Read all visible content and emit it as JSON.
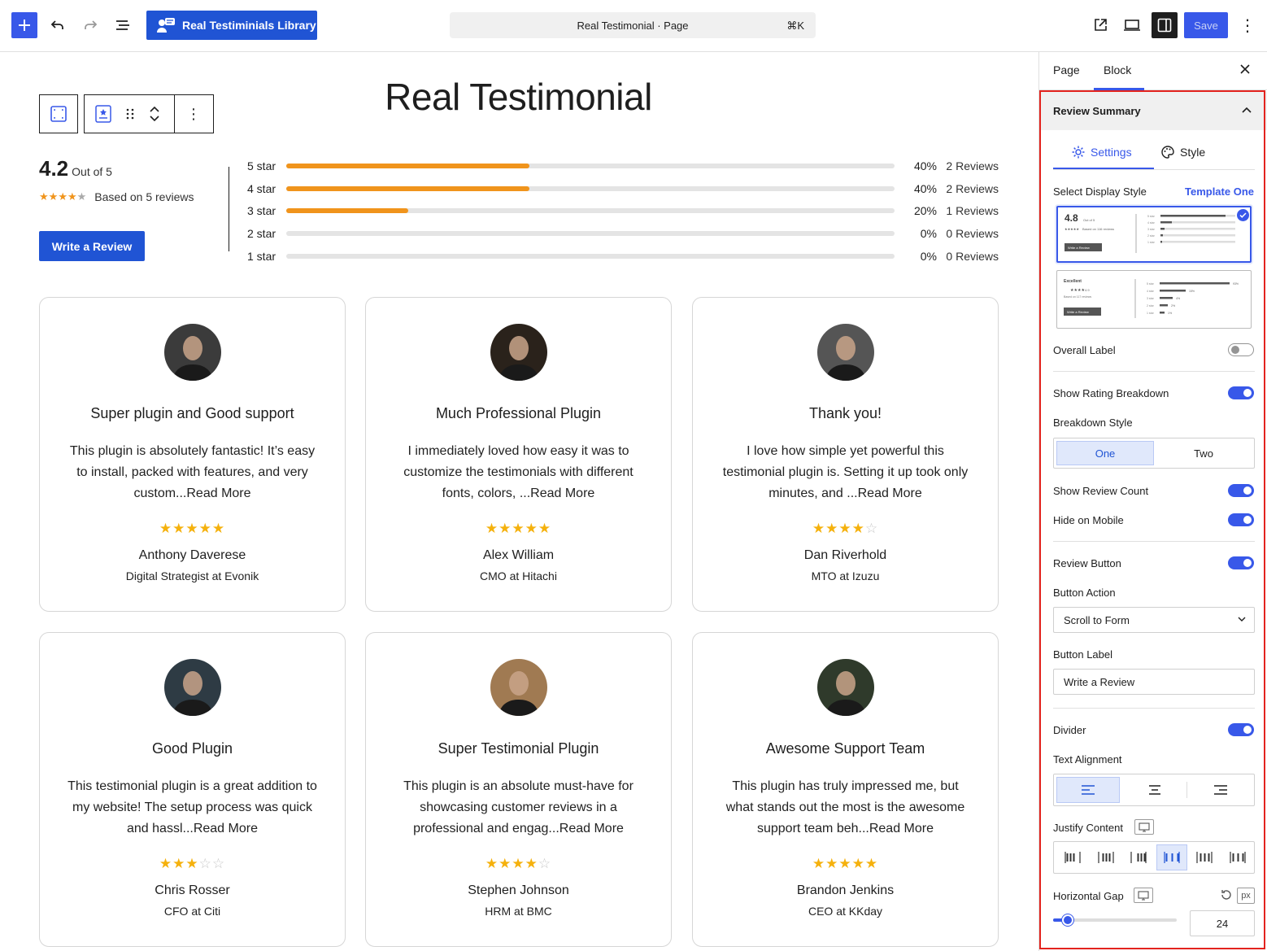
{
  "topbar": {
    "library_label": "Real Testiminials Library",
    "doc_title": "Real Testimonial · Page",
    "shortcut": "⌘K",
    "save_label": "Save"
  },
  "page": {
    "heading": "Real Testimonial"
  },
  "summary": {
    "average": "4.2",
    "out_of": "Out of 5",
    "based_on": "Based on 5 reviews",
    "average_stars": 4,
    "write_button": "Write a Review",
    "breakdown": [
      {
        "label": "5 star",
        "percent_text": "40%",
        "percent": 40,
        "count": "2 Reviews"
      },
      {
        "label": "4 star",
        "percent_text": "40%",
        "percent": 40,
        "count": "2 Reviews"
      },
      {
        "label": "3 star",
        "percent_text": "20%",
        "percent": 20,
        "count": "1 Reviews"
      },
      {
        "label": "2 star",
        "percent_text": "0%",
        "percent": 0,
        "count": "0 Reviews"
      },
      {
        "label": "1 star",
        "percent_text": "0%",
        "percent": 0,
        "count": "0 Reviews"
      }
    ]
  },
  "testimonials": [
    {
      "title": "Super plugin and Good support",
      "body": "This plugin is absolutely fantastic! It’s easy to install, packed with features, and very custom...Read More",
      "rating": 5,
      "name": "Anthony Daverese",
      "role": "Digital Strategist at Evonik",
      "avatar_color": "#3b3b3b"
    },
    {
      "title": "Much Professional Plugin",
      "body": "I immediately loved how easy it was to customize the testimonials with different fonts, colors, ...Read More",
      "rating": 5,
      "name": "Alex William",
      "role": "CMO at Hitachi",
      "avatar_color": "#2a221b"
    },
    {
      "title": "Thank you!",
      "body": "I love how simple yet powerful this testimonial plugin is. Setting it up took only minutes, and ...Read More",
      "rating": 4,
      "name": "Dan Riverhold",
      "role": "MTO at Izuzu",
      "avatar_color": "#555555"
    },
    {
      "title": "Good Plugin",
      "body": "This testimonial plugin is a great addition to my website! The setup process was quick and hassl...Read More",
      "rating": 3,
      "name": "Chris Rosser",
      "role": "CFO at Citi",
      "avatar_color": "#2e3b44"
    },
    {
      "title": "Super Testimonial Plugin",
      "body": "This plugin is an absolute must-have for showcasing customer reviews in a professional and engag...Read More",
      "rating": 4,
      "name": "Stephen Johnson",
      "role": "HRM at BMC",
      "avatar_color": "#a07a52"
    },
    {
      "title": "Awesome Support Team",
      "body": "This plugin has truly impressed me, but what stands out the most is the awesome support team beh...Read More",
      "rating": 5,
      "name": "Brandon Jenkins",
      "role": "CEO at KKday",
      "avatar_color": "#2f3a2b"
    }
  ],
  "panel": {
    "tab_page": "Page",
    "tab_block": "Block",
    "section_title": "Review Summary",
    "subtab_settings": "Settings",
    "subtab_style": "Style",
    "display_style_label": "Select Display Style",
    "display_style_value": "Template One",
    "thumb1": {
      "rating": "4.8",
      "out": "Out of 5",
      "based": "Based on 116 reviews",
      "btn": "Write a Review"
    },
    "thumb2": {
      "label": "Excellent",
      "rating": "4.9",
      "based": "Based on 117 reviews",
      "btn": "Write a Review",
      "p1": "93%",
      "p2": "15%",
      "p3": "4%",
      "p4": "2%",
      "p5": "1%"
    },
    "overall_label": "Overall Label",
    "overall_label_on": false,
    "show_breakdown": "Show Rating Breakdown",
    "show_breakdown_on": true,
    "breakdown_style": "Breakdown Style",
    "breakdown_one": "One",
    "breakdown_two": "Two",
    "show_count": "Show Review Count",
    "show_count_on": true,
    "hide_mobile": "Hide on Mobile",
    "hide_mobile_on": true,
    "review_button": "Review Button",
    "review_button_on": true,
    "button_action": "Button Action",
    "button_action_value": "Scroll to Form",
    "button_label": "Button Label",
    "button_label_value": "Write a Review",
    "divider": "Divider",
    "divider_on": true,
    "text_alignment": "Text Alignment",
    "justify_content": "Justify Content",
    "horizontal_gap": "Horizontal Gap",
    "gap_unit": "px",
    "gap_value": "24",
    "gap_slider_fraction": 0.12
  },
  "colors": {
    "accent": "#3858e9",
    "brand_button": "#2054d4",
    "bar_fill": "#f0941c",
    "star": "#f5b10d",
    "highlight_frame": "#e3231e"
  }
}
